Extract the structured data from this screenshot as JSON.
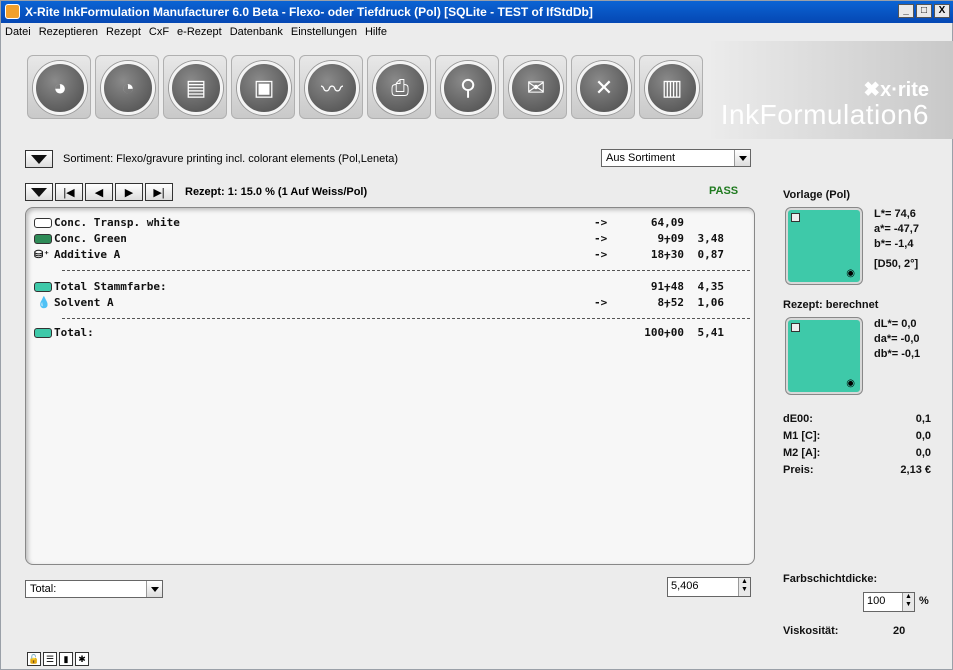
{
  "window": {
    "title": "X-Rite InkFormulation Manufacturer 6.0 Beta - Flexo- oder Tiefdruck (Pol)  [SQLite - TEST of IfStdDb]",
    "controls": [
      "_",
      "□",
      "X"
    ]
  },
  "menu": [
    "Datei",
    "Rezeptieren",
    "Rezept",
    "CxF",
    "e-Rezept",
    "Datenbank",
    "Einstellungen",
    "Hilfe"
  ],
  "toolbar": {
    "buttons": [
      {
        "name": "new-recipe-icon",
        "glyph": "◕"
      },
      {
        "name": "recipe-cup-icon",
        "glyph": "◔"
      },
      {
        "name": "open-folder-icon",
        "glyph": "▤"
      },
      {
        "name": "save-disk-icon",
        "glyph": "▣"
      },
      {
        "name": "chart-icon",
        "glyph": "〰"
      },
      {
        "name": "print-icon",
        "glyph": "⎙"
      },
      {
        "name": "tap-icon",
        "glyph": "⚲"
      },
      {
        "name": "email-icon",
        "glyph": "✉"
      },
      {
        "name": "delete-recipe-icon",
        "glyph": "✕"
      },
      {
        "name": "bar-chart-icon",
        "glyph": "▥"
      }
    ]
  },
  "brand": {
    "logo": "✖x·rite",
    "name": "InkFormulation6"
  },
  "sortiment": {
    "label": "Sortiment: Flexo/gravure printing incl. colorant elements  (Pol,Leneta)",
    "dropdown": "Aus Sortiment"
  },
  "recipe": {
    "label": "Rezept: 1:  15.0 %   (1 Auf Weiss/Pol)",
    "status": "PASS"
  },
  "rows": [
    {
      "label": "Conc. Transp. white",
      "arrow": "->",
      "value": "64,09",
      "plus": "",
      "add": "",
      "color": "#ffffff"
    },
    {
      "label": "Conc. Green",
      "arrow": "->",
      "value": "9,09",
      "plus": "+",
      "add": "3,48",
      "color": "#2e8b57"
    },
    {
      "label": "Additive A",
      "arrow": "->",
      "value": "18,30",
      "plus": "+",
      "add": "0,87",
      "color": ""
    },
    {
      "label": "Total Stammfarbe:",
      "arrow": "",
      "value": "91,48",
      "plus": "+",
      "add": "4,35",
      "color": "#3ec9a9"
    },
    {
      "label": "Solvent A",
      "arrow": "->",
      "value": "8,52",
      "plus": "+",
      "add": "1,06",
      "color": ""
    },
    {
      "label": "Total:",
      "arrow": "",
      "value": "100,00",
      "plus": "+",
      "add": "5,41",
      "color": "#3ec9a9"
    }
  ],
  "bottom": {
    "total_select": "Total:",
    "amount": "5,406"
  },
  "side": {
    "vorlage_title": "Vorlage (Pol)",
    "vorlage_values": [
      "L*=  74,6",
      "a*= -47,7",
      "b*=  -1,4",
      "[D50, 2°]"
    ],
    "rezept_title": "Rezept: berechnet",
    "rezept_values": [
      "dL*=  0,0",
      "da*= -0,0",
      "db*= -0,1"
    ],
    "metrics": [
      {
        "label": "dE00:",
        "value": "0,1"
      },
      {
        "label": "M1 [C]:",
        "value": "0,0"
      },
      {
        "label": "M2 [A]:",
        "value": "0,0"
      },
      {
        "label": "Preis:",
        "value": "2,13 €"
      }
    ],
    "farbschicht_label": "Farbschichtdicke:",
    "farbschicht_value": "100",
    "farbschicht_unit": "%",
    "viskositaet_label": "Viskosität:",
    "viskositaet_value": "20"
  },
  "colors": {
    "target": "#3ec9a9",
    "pass": "#1f7a1f"
  }
}
